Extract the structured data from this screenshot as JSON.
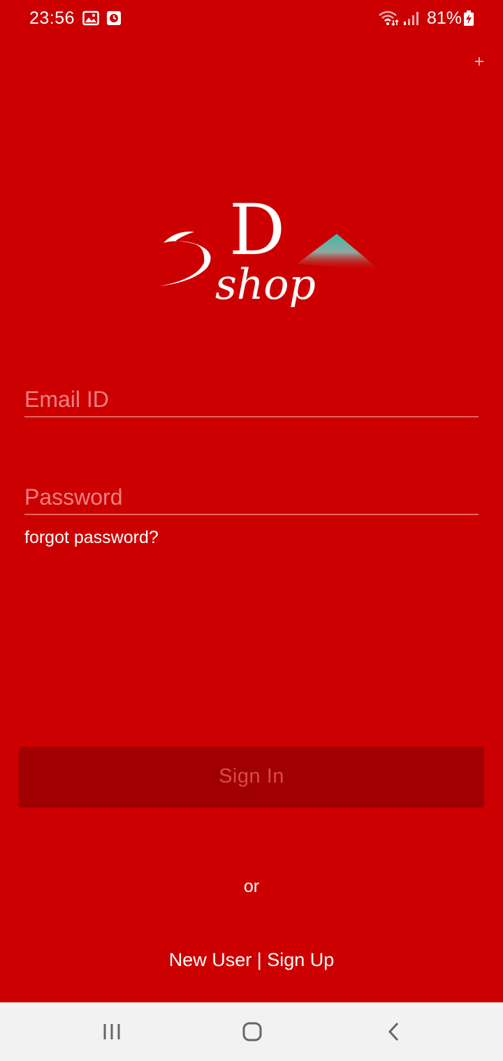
{
  "status_bar": {
    "time": "23:56",
    "battery_percent": "81%",
    "icons": [
      "image-icon",
      "clock-icon",
      "wifi-icon",
      "signal-icon",
      "battery-charging-icon"
    ]
  },
  "header": {
    "corner_icon": "plus-icon"
  },
  "logo": {
    "primary_text": "5D",
    "secondary_text": "shop",
    "accent_color": "#3cbba6"
  },
  "form": {
    "email": {
      "placeholder": "Email ID",
      "value": ""
    },
    "password": {
      "placeholder": "Password",
      "value": ""
    },
    "forgot_label": "forgot password?",
    "signin_label": "Sign In"
  },
  "footer": {
    "or_label": "or",
    "signup_label": "New User | Sign Up"
  },
  "nav_bar": {
    "icons": [
      "recent-apps-icon",
      "home-icon",
      "back-icon"
    ]
  },
  "colors": {
    "background": "#cc0000",
    "button": "#a00000",
    "button_text": "#d84b4b",
    "placeholder": "#f08080",
    "nav_background": "#f2f2f2"
  }
}
